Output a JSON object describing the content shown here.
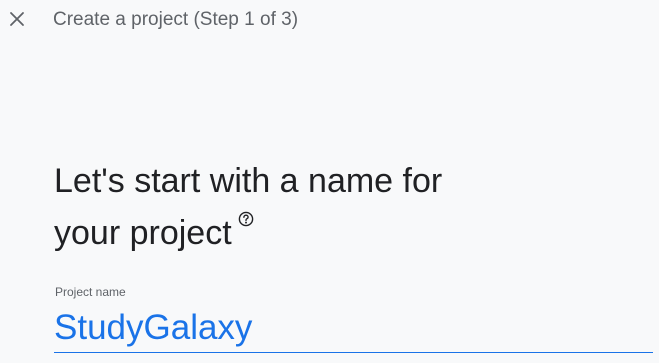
{
  "header": {
    "close_icon": "close-icon",
    "step_title": "Create a project (Step 1 of 3)"
  },
  "main": {
    "heading_line1": "Let's start with a name for",
    "heading_line2": "your project",
    "help_icon": "help-circle-icon"
  },
  "project_name_field": {
    "label": "Project name",
    "value": "StudyGalaxy"
  },
  "colors": {
    "accent": "#1a73e8",
    "background": "#f8f9fa",
    "text_primary": "#202124",
    "text_secondary": "#5f6368"
  }
}
